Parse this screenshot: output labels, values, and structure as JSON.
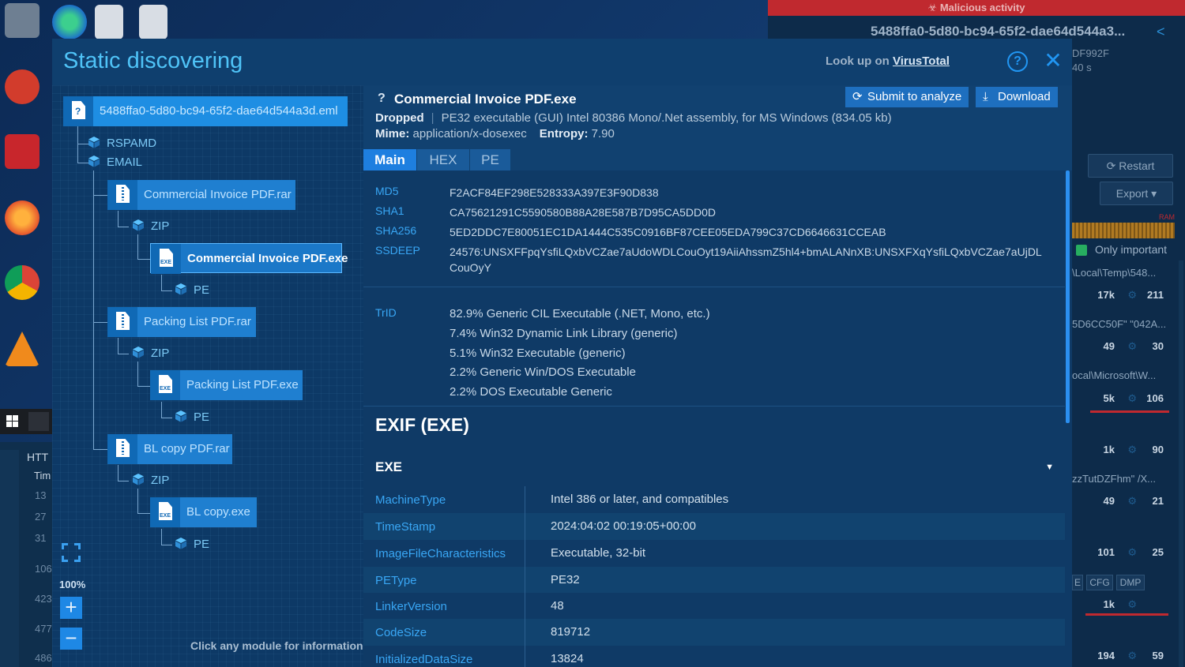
{
  "background": {
    "malicious_label": "Malicious activity",
    "task_title": "5488ffa0-5d80-bc94-65f2-dae64d544a3...",
    "meta_hash": "DF992F",
    "meta_time": "40 s",
    "restart_label": "Restart",
    "export_label": "Export",
    "ram_label": "RAM",
    "only_important_label": "Only important",
    "process_paths": [
      "\\Local\\Temp\\548...",
      "5D6CC50F\" \"042A...",
      "ocal\\Microsoft\\W...",
      "zzTutDZFhm\" /X..."
    ],
    "stats": [
      {
        "a": "17k",
        "b": "211"
      },
      {
        "a": "49",
        "b": "30"
      },
      {
        "a": "5k",
        "b": "106"
      },
      {
        "a": "1k",
        "b": "90"
      },
      {
        "a": "49",
        "b": "21"
      },
      {
        "a": "101",
        "b": "25"
      },
      {
        "a": "1k",
        "b": ""
      },
      {
        "a": "194",
        "b": "59"
      }
    ],
    "tags": [
      "E",
      "CFG",
      "DMP"
    ],
    "left_http": "HTT",
    "left_time": "Tim",
    "left_numbers": [
      "13",
      "27",
      "31",
      "106",
      "423",
      "477",
      "486"
    ]
  },
  "modal": {
    "title": "Static discovering",
    "lookup_prefix": "Look up on ",
    "lookup_link": "VirusTotal",
    "help_symbol": "?",
    "close_symbol": "✕"
  },
  "tree": {
    "root": "5488ffa0-5d80-bc94-65f2-dae64d544a3d.eml",
    "rspamd": "RSPAMD",
    "email": "EMAIL",
    "archives": [
      {
        "name": "Commercial Invoice PDF.rar",
        "zip": "ZIP",
        "exe": "Commercial Invoice PDF.exe",
        "pe": "PE"
      },
      {
        "name": "Packing List PDF.rar",
        "zip": "ZIP",
        "exe": "Packing List PDF.exe",
        "pe": "PE"
      },
      {
        "name": "BL copy PDF.rar",
        "zip": "ZIP",
        "exe": "BL copy.exe",
        "pe": "PE"
      }
    ],
    "zoom": "100%",
    "zoom_in": "+",
    "zoom_out": "−",
    "hint": "Click any module for information"
  },
  "file": {
    "question": "?",
    "name": "Commercial Invoice PDF.exe",
    "submit_label": "Submit to analyze",
    "download_label": "Download",
    "dropped_label": "Dropped",
    "description": "PE32 executable (GUI) Intel 80386 Mono/.Net assembly, for MS Windows (834.05 kb)",
    "mime_label": "Mime:",
    "mime_value": "application/x-dosexec",
    "entropy_label": "Entropy:",
    "entropy_value": "7.90"
  },
  "tabs": [
    "Main",
    "HEX",
    "PE"
  ],
  "hashes": [
    {
      "k": "MD5",
      "v": "F2ACF84EF298E528333A397E3F90D838"
    },
    {
      "k": "SHA1",
      "v": "CA75621291C5590580B88A28E587B7D95CA5DD0D"
    },
    {
      "k": "SHA256",
      "v": "5ED2DDC7E80051EC1DA1444C535C0916BF87CEE05EDA799C37CD6646631CCEAB"
    },
    {
      "k": "SSDEEP",
      "v": "24576:UNSXFFpqYsfiLQxbVCZae7aUdoWDLCouOyt19AiiAhssmZ5hl4+bmALANnXB:UNSXFXqYsfiLQxbVCZae7aUjDL CouOyY"
    }
  ],
  "trid": {
    "label": "TrID",
    "items": [
      "82.9% Generic CIL Executable (.NET, Mono, etc.)",
      "7.4% Win32 Dynamic Link Library (generic)",
      "5.1% Win32 Executable (generic)",
      "2.2% Generic Win/DOS Executable",
      "2.2% DOS Executable Generic"
    ]
  },
  "exif": {
    "title": "EXIF (EXE)",
    "section": "EXE",
    "rows": [
      {
        "k": "MachineType",
        "v": "Intel 386 or later, and compatibles"
      },
      {
        "k": "TimeStamp",
        "v": "2024:04:02 00:19:05+00:00"
      },
      {
        "k": "ImageFileCharacteristics",
        "v": "Executable, 32-bit"
      },
      {
        "k": "PEType",
        "v": "PE32"
      },
      {
        "k": "LinkerVersion",
        "v": "48"
      },
      {
        "k": "CodeSize",
        "v": "819712"
      },
      {
        "k": "InitializedDataSize",
        "v": "13824"
      }
    ]
  }
}
